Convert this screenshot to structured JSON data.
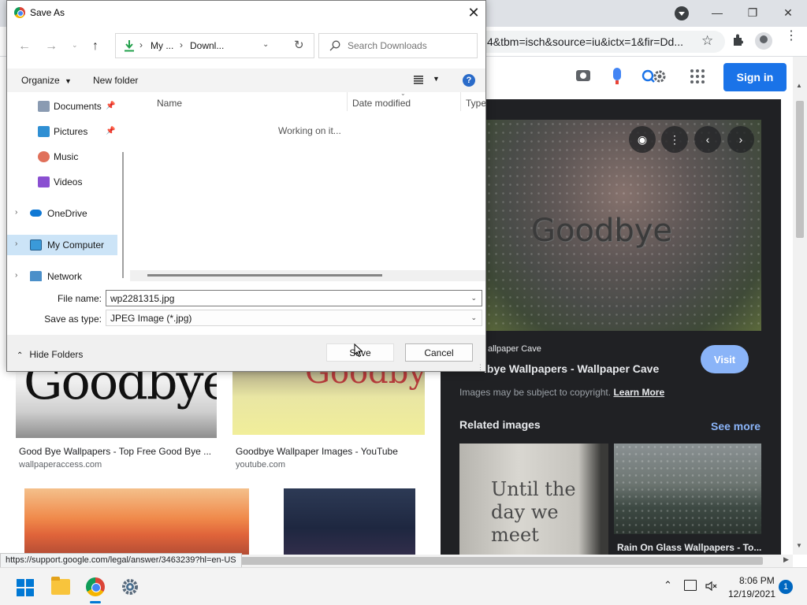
{
  "dialog": {
    "title": "Save As",
    "breadcrumb": [
      "My ...",
      "Downl..."
    ],
    "search_placeholder": "Search Downloads",
    "organize_label": "Organize",
    "new_folder_label": "New folder",
    "help_glyph": "?",
    "nav_items": [
      {
        "label": "Documents",
        "icon": "documents-icon",
        "pinned": true
      },
      {
        "label": "Pictures",
        "icon": "pictures-icon",
        "pinned": true
      },
      {
        "label": "Music",
        "icon": "music-icon",
        "pinned": false
      },
      {
        "label": "Videos",
        "icon": "videos-icon",
        "pinned": false
      },
      {
        "label": "OneDrive",
        "icon": "onedrive-icon",
        "expandable": true
      },
      {
        "label": "My Computer",
        "icon": "computer-icon",
        "expandable": true,
        "selected": true
      },
      {
        "label": "Network",
        "icon": "network-icon",
        "expandable": true
      }
    ],
    "columns": [
      "Name",
      "Date modified",
      "Type"
    ],
    "status_message": "Working on it...",
    "file_name_label": "File name:",
    "file_name_value": "wp2281315.jpg",
    "save_type_label": "Save as type:",
    "save_type_value": "JPEG Image (*.jpg)",
    "hide_folders_label": "Hide Folders",
    "save_label": "Save",
    "cancel_label": "Cancel"
  },
  "browser": {
    "url_fragment": "4&tbm=isch&source=iu&ictx=1&fir=Dd...",
    "signin_label": "Sign in",
    "status_bar_url": "https://support.google.com/legal/answer/3463239?hl=en-US"
  },
  "results": [
    {
      "title": "Good Bye Wallpapers - Top Free Good Bye ...",
      "source": "wallpaperaccess.com",
      "image_text": "Goodbye"
    },
    {
      "title": "Goodbye Wallpaper Images - YouTube",
      "source": "youtube.com",
      "image_text": "Goodbye!"
    }
  ],
  "preview": {
    "image_text": "Goodbye",
    "source": "allpaper Cave",
    "title": "lbye Wallpapers - Wallpaper Cave",
    "visit_label": "Visit",
    "copyright": "Images may be subject to copyright.",
    "learn_more_label": "Learn More",
    "related_heading": "Related images",
    "see_more_label": "See more",
    "related": [
      {
        "image_text": "Until the day we meet",
        "title": ""
      },
      {
        "image_text": "",
        "title": "Rain On Glass Wallpapers - To..."
      }
    ]
  },
  "taskbar": {
    "time": "8:06 PM",
    "date": "12/19/2021",
    "notification_count": "1"
  },
  "colors": {
    "accent": "#1a73e8",
    "visit_button": "#8ab4f8",
    "preview_bg": "#202124",
    "nav_selected": "#cce4f7",
    "windows_blue": "#0078d4"
  }
}
